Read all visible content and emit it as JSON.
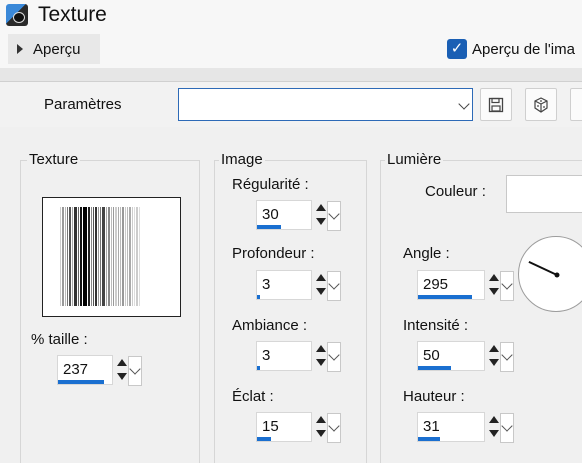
{
  "window": {
    "title": "Texture"
  },
  "preview": {
    "label": "Aperçu",
    "checkbox_label": "Aperçu de l'ima",
    "checked": true
  },
  "params": {
    "label": "Paramètres",
    "value": ""
  },
  "texture_group": {
    "title": "Texture",
    "size_label": "% taille :",
    "size_value": "237",
    "size_fraction": 0.85
  },
  "image_group": {
    "title": "Image",
    "fields": [
      {
        "label": "Régularité :",
        "value": "30",
        "fraction": 0.45
      },
      {
        "label": "Profondeur :",
        "value": "3",
        "fraction": 0.05
      },
      {
        "label": "Ambiance :",
        "value": "3",
        "fraction": 0.05
      },
      {
        "label": "Éclat :",
        "value": "15",
        "fraction": 0.25
      }
    ]
  },
  "light_group": {
    "title": "Lumière",
    "color_label": "Couleur :",
    "color_value": "#ffffff",
    "angle_label": "Angle :",
    "angle_value": "295",
    "angle_fraction": 0.82,
    "intensity_label": "Intensité :",
    "intensity_value": "50",
    "intensity_fraction": 0.5,
    "height_label": "Hauteur :",
    "height_value": "31",
    "height_fraction": 0.34
  },
  "icons": {
    "app": "texture-app-icon",
    "expand": "triangle-right-icon",
    "save": "save-icon",
    "random": "dice-icon"
  },
  "colors": {
    "accent": "#1a6fd0",
    "check": "#1a5fb4"
  }
}
